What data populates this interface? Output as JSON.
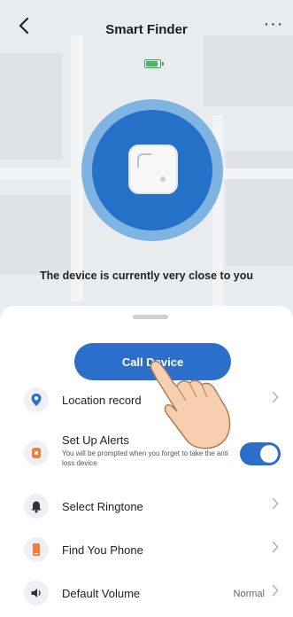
{
  "header": {
    "title": "Smart Finder",
    "back_icon": "chevron-left-icon",
    "more_icon": "more-dots-icon",
    "more_glyph": "···"
  },
  "device": {
    "battery_level": 0.9,
    "status_text": "The device is currently very close to you"
  },
  "sheet": {
    "call_button_label": "Call Device",
    "items": [
      {
        "label": "Location record",
        "icon": "location-pin-icon",
        "has_chevron": true
      },
      {
        "label": "Set Up Alerts",
        "subtitle": "You will be prompted when you forget to take the anti loss device",
        "icon": "alert-icon",
        "toggle_on": true
      },
      {
        "label": "Select Ringtone",
        "icon": "bell-icon",
        "has_chevron": true
      },
      {
        "label": "Find You Phone",
        "icon": "phone-icon",
        "has_chevron": true
      },
      {
        "label": "Default Volume",
        "icon": "speaker-icon",
        "value": "Normal",
        "has_chevron": true
      }
    ]
  },
  "colors": {
    "accent": "#2b6fca",
    "radar_outer": "#7fb3e2",
    "radar_inner": "#2671c8",
    "location_icon": "#2b6fca",
    "alert_icon": "#f07e3b",
    "phone_icon": "#f07e3b",
    "battery": "#3dc05a"
  }
}
